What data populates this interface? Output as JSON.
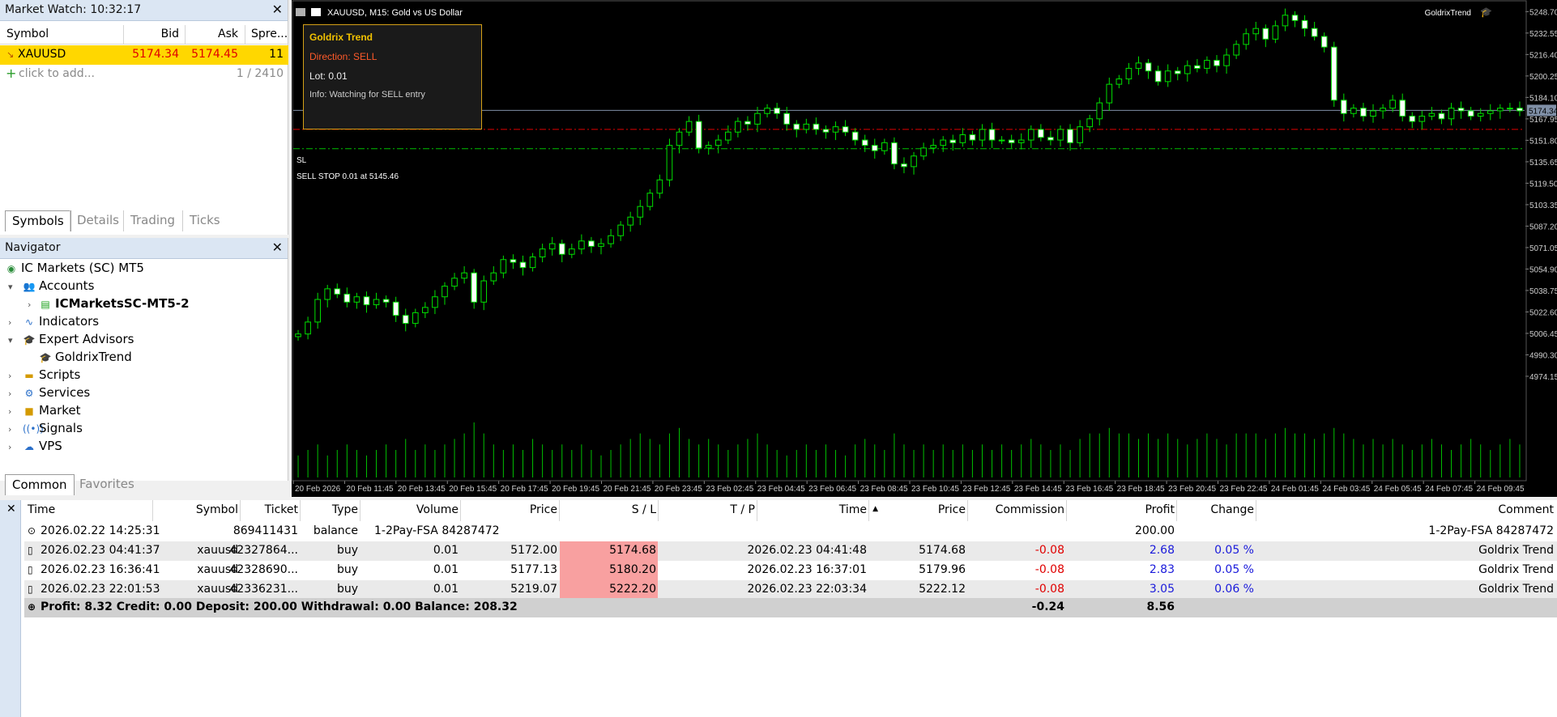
{
  "market_watch": {
    "title": "Market Watch: 10:32:17",
    "columns": [
      "Symbol",
      "Bid",
      "Ask",
      "Spre..."
    ],
    "row": {
      "symbol": "XAUUSD",
      "bid": "5174.34",
      "ask": "5174.45",
      "spread": "11"
    },
    "add_label": "click to add...",
    "count": "1 / 2410",
    "tabs": [
      "Symbols",
      "Details",
      "Trading",
      "Ticks"
    ]
  },
  "navigator": {
    "title": "Navigator",
    "items": [
      {
        "label": "IC Markets (SC) MT5",
        "icon": "broker-icon"
      },
      {
        "label": "Accounts",
        "icon": "accounts-icon"
      },
      {
        "label": "ICMarketsSC-MT5-2",
        "icon": "account-server-icon"
      },
      {
        "label": "Indicators",
        "icon": "indicators-icon"
      },
      {
        "label": "Expert Advisors",
        "icon": "expert-advisors-icon"
      },
      {
        "label": "GoldrixTrend",
        "icon": "expert-icon"
      },
      {
        "label": "Scripts",
        "icon": "scripts-icon"
      },
      {
        "label": "Services",
        "icon": "services-icon"
      },
      {
        "label": "Market",
        "icon": "market-icon"
      },
      {
        "label": "Signals",
        "icon": "signals-icon"
      },
      {
        "label": "VPS",
        "icon": "vps-icon"
      }
    ],
    "tabs": [
      "Common",
      "Favorites"
    ]
  },
  "chart": {
    "header": "XAUUSD, M15:  Gold vs US Dollar",
    "ea_label": "GoldrixTrend",
    "info_box": {
      "title": "Goldrix Trend",
      "direction": "Direction: SELL",
      "lot": "Lot: 0.01",
      "info": "Info: Watching for SELL entry"
    },
    "sl_label": "SL",
    "sell_stop_label": "SELL STOP 0.01 at 5145.46",
    "current_price_label": "5174.34",
    "colors": {
      "bull": "#00e000",
      "bear": "#ffffff",
      "bid_line": "#7f8fa6",
      "sl_line": "#e00000",
      "order_line": "#00c000",
      "volume": "#00c000"
    },
    "price_axis": [
      "5248.70",
      "5232.55",
      "5216.40",
      "5200.25",
      "5184.10",
      "5167.95",
      "5151.80",
      "5135.65",
      "5119.50",
      "5103.35",
      "5087.20",
      "5071.05",
      "5054.90",
      "5038.75",
      "5022.60",
      "5006.45",
      "4990.30",
      "4974.15"
    ],
    "time_axis": [
      "20 Feb 2026",
      "20 Feb 11:45",
      "20 Feb 13:45",
      "20 Feb 15:45",
      "20 Feb 17:45",
      "20 Feb 19:45",
      "20 Feb 21:45",
      "20 Feb 23:45",
      "23 Feb 02:45",
      "23 Feb 04:45",
      "23 Feb 06:45",
      "23 Feb 08:45",
      "23 Feb 10:45",
      "23 Feb 12:45",
      "23 Feb 14:45",
      "23 Feb 16:45",
      "23 Feb 18:45",
      "23 Feb 20:45",
      "23 Feb 22:45",
      "24 Feb 01:45",
      "24 Feb 03:45",
      "24 Feb 05:45",
      "24 Feb 07:45",
      "24 Feb 09:45"
    ]
  },
  "chart_data": {
    "type": "candlestick",
    "title": "XAUUSD, M15:  Gold vs US Dollar",
    "ylim": [
      4965,
      5255
    ],
    "closes": [
      5006,
      5015,
      5032,
      5040,
      5036,
      5030,
      5034,
      5028,
      5032,
      5030,
      5020,
      5014,
      5022,
      5026,
      5034,
      5042,
      5048,
      5052,
      5030,
      5046,
      5052,
      5062,
      5060,
      5056,
      5064,
      5070,
      5074,
      5066,
      5070,
      5076,
      5072,
      5074,
      5080,
      5088,
      5094,
      5102,
      5112,
      5122,
      5148,
      5158,
      5166,
      5146,
      5148,
      5152,
      5158,
      5166,
      5164,
      5172,
      5176,
      5172,
      5164,
      5160,
      5164,
      5160,
      5158,
      5162,
      5158,
      5152,
      5148,
      5144,
      5150,
      5134,
      5132,
      5140,
      5146,
      5148,
      5152,
      5150,
      5156,
      5152,
      5160,
      5152,
      5152,
      5150,
      5152,
      5160,
      5154,
      5152,
      5160,
      5150,
      5162,
      5168,
      5180,
      5194,
      5198,
      5206,
      5210,
      5204,
      5196,
      5204,
      5202,
      5208,
      5206,
      5212,
      5208,
      5216,
      5224,
      5232,
      5236,
      5228,
      5238,
      5246,
      5242,
      5236,
      5230,
      5222,
      5182,
      5172,
      5176,
      5170,
      5174,
      5176,
      5182,
      5170,
      5166,
      5170,
      5172,
      5168,
      5176,
      5174,
      5170,
      5172,
      5174,
      5176,
      5176,
      5174
    ],
    "volume_rel": [
      0.4,
      0.5,
      0.6,
      0.4,
      0.5,
      0.6,
      0.5,
      0.4,
      0.5,
      0.6,
      0.5,
      0.7,
      0.5,
      0.6,
      0.5,
      0.6,
      0.7,
      0.8,
      1.0,
      0.8,
      0.6,
      0.5,
      0.6,
      0.5,
      0.7,
      0.6,
      0.5,
      0.6,
      0.5,
      0.6,
      0.5,
      0.4,
      0.5,
      0.6,
      0.7,
      0.8,
      0.7,
      0.6,
      0.8,
      0.9,
      0.7,
      0.6,
      0.7,
      0.6,
      0.5,
      0.6,
      0.7,
      0.8,
      0.6,
      0.5,
      0.4,
      0.5,
      0.6,
      0.5,
      0.6,
      0.5,
      0.4,
      0.6,
      0.7,
      0.6,
      0.5,
      0.8,
      0.6,
      0.5,
      0.6,
      0.5,
      0.6,
      0.5,
      0.6,
      0.5,
      0.6,
      0.5,
      0.6,
      0.5,
      0.6,
      0.7,
      0.6,
      0.5,
      0.6,
      0.5,
      0.7,
      0.8,
      0.8,
      0.9,
      0.8,
      0.8,
      0.7,
      0.8,
      0.7,
      0.8,
      0.7,
      0.6,
      0.7,
      0.8,
      0.7,
      0.6,
      0.8,
      0.8,
      0.8,
      0.7,
      0.8,
      0.9,
      0.8,
      0.8,
      0.7,
      0.8,
      0.9,
      0.8,
      0.7,
      0.6,
      0.7,
      0.6,
      0.7,
      0.6,
      0.5,
      0.6,
      0.7,
      0.6,
      0.5,
      0.6,
      0.7,
      0.6,
      0.5,
      0.6,
      0.7,
      0.6
    ],
    "bid": 5174.34,
    "stop_loss": 5160.0,
    "sell_stop": 5145.46
  },
  "history": {
    "columns": [
      "Time",
      "Symbol",
      "Ticket",
      "Type",
      "Volume",
      "Price",
      "S / L",
      "T / P",
      "Time",
      "Price",
      "Commission",
      "Profit",
      "Change",
      "Comment"
    ],
    "balance_row": {
      "time": "2026.02.22 14:25:31",
      "ticket": "869411431",
      "type": "balance",
      "volume": "1-2Pay-FSA 84287472",
      "profit": "200.00",
      "comment": "1-2Pay-FSA 84287472"
    },
    "rows": [
      {
        "time": "2026.02.23 04:41:37",
        "symbol": "xauusd",
        "ticket": "42327864...",
        "type": "buy",
        "volume": "0.01",
        "price": "5172.00",
        "sl": "5174.68",
        "tp": "",
        "close_time": "2026.02.23 04:41:48",
        "close_price": "5174.68",
        "commission": "-0.08",
        "profit": "2.68",
        "change": "0.05 %",
        "comment": "Goldrix Trend"
      },
      {
        "time": "2026.02.23 16:36:41",
        "symbol": "xauusd",
        "ticket": "42328690...",
        "type": "buy",
        "volume": "0.01",
        "price": "5177.13",
        "sl": "5180.20",
        "tp": "",
        "close_time": "2026.02.23 16:37:01",
        "close_price": "5179.96",
        "commission": "-0.08",
        "profit": "2.83",
        "change": "0.05 %",
        "comment": "Goldrix Trend"
      },
      {
        "time": "2026.02.23 22:01:53",
        "symbol": "xauusd",
        "ticket": "42336231...",
        "type": "buy",
        "volume": "0.01",
        "price": "5219.07",
        "sl": "5222.20",
        "tp": "",
        "close_time": "2026.02.23 22:03:34",
        "close_price": "5222.12",
        "commission": "-0.08",
        "profit": "3.05",
        "change": "0.06 %",
        "comment": "Goldrix Trend"
      }
    ],
    "totals": {
      "summary": "Profit: 8.32  Credit: 0.00  Deposit: 200.00  Withdrawal: 0.00  Balance: 208.32",
      "commission": "-0.24",
      "profit": "8.56"
    }
  }
}
